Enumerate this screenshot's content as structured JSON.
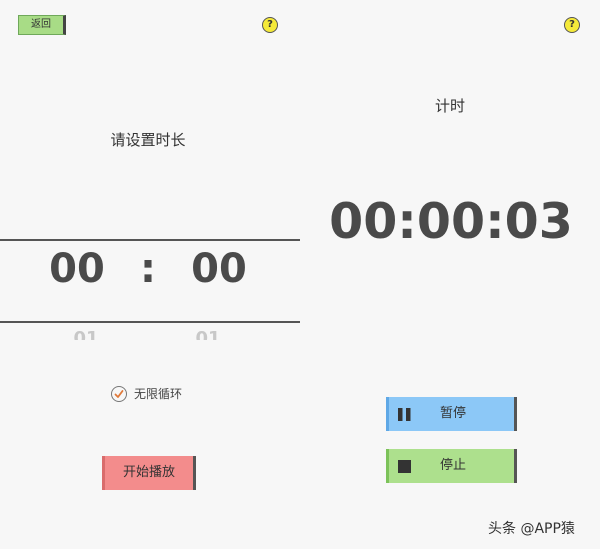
{
  "left_screen": {
    "back_label": "返回",
    "help_label": "?",
    "title": "请设置时长",
    "picker": {
      "minutes": "00",
      "separator": ":",
      "seconds": "00",
      "next_minutes": "01",
      "next_seconds": "01"
    },
    "loop": {
      "label": "无限循环",
      "checked": true
    },
    "start_label": "开始播放",
    "start_color": "#f38c8c"
  },
  "right_screen": {
    "help_label": "?",
    "title": "计时",
    "elapsed": "00:00:03",
    "pause": {
      "label": "暂停",
      "icon": "pause-icon",
      "color": "#8cc8f7"
    },
    "stop": {
      "label": "停止",
      "icon": "stop-icon",
      "color": "#ade08d"
    }
  },
  "watermark": "头条 @APP猿"
}
